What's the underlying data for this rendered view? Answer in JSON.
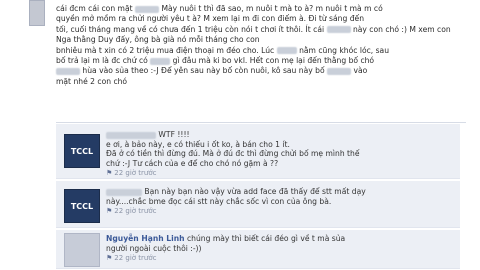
{
  "post": {
    "lines": [
      "cái đcm cái con mặt",
      "Mày nuôi t thì đã sao, m nuôi t mà to à? m nuôi t mà m có",
      "quyền mở mồm ra chửi người yêu t à? M xem lại m đi con điếm à. Đi từ sáng đến",
      "tối, cuối tháng mang về có chưa đến 1 triệu còn nói t chơi ít thôi. Ít cái",
      "này con chó :) M xem con Nga thằng Duy đấy, ông bà già nó mỗi tháng cho con",
      "bnhiêu mà t xin có 2 triệu mua điện thoại m đéo cho. Lúc",
      "nằm cũng khóc lóc, sau",
      "bố trả lại m là đc chứ có",
      "gì đâu mà ki bo vkl. Hết con mẹ lại đến thằng bố chó",
      "hùa vào sủa theo :-J Để yên sau này bố còn nuôi, kô sau này bố",
      "vào",
      "mặt nhé 2 con chó"
    ]
  },
  "comments": [
    {
      "avatar_label": "TCCL",
      "name": "",
      "lines": [
        "WTF !!!!",
        "e ơi, à bảo này, e có thiếu i ốt ko, à bán cho 1 ít.",
        "Đã ở có tiền thì đừng đú. Mà ở đú đc thì đừng chửi bố mẹ mình thế",
        "chứ :-J Tư cách của e để cho chó nó gặm à ??"
      ],
      "time": "22 giờ trước"
    },
    {
      "avatar_label": "TCCL",
      "name": "",
      "lines": [
        "Bạn này bạn nào vậy vừa add face đã thấy để stt mất dạy",
        "này....chắc bme đọc cái stt này chắc sốc vì con của ông bà."
      ],
      "time": "22 giờ trước"
    },
    {
      "avatar_label": "",
      "name": "Nguyễn Hạnh Linh",
      "lines": [
        "chúng mày thì biết cái đéo gì về t mà sủa",
        "người ngoài cuộc thôi :-))"
      ],
      "time": "22 giờ trước"
    }
  ]
}
